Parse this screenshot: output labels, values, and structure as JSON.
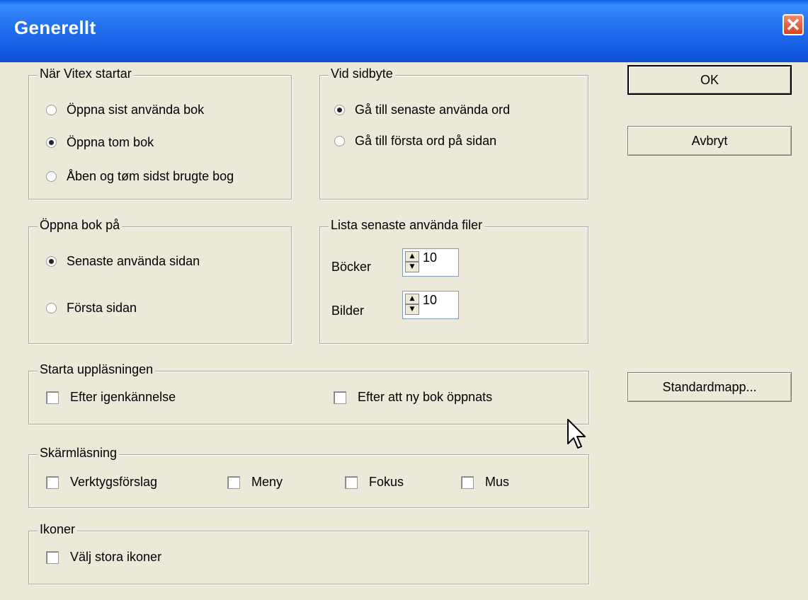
{
  "window": {
    "title": "Generellt",
    "close_label": "✕"
  },
  "groups": {
    "startup": {
      "label": "När Vitex startar",
      "options": [
        {
          "label": "Öppna sist använda bok",
          "selected": false
        },
        {
          "label": "Öppna tom bok",
          "selected": true
        },
        {
          "label": "Åben og tøm sidst brugte bog",
          "selected": false
        }
      ]
    },
    "pagechange": {
      "label": "Vid sidbyte",
      "options": [
        {
          "label": "Gå till senaste använda ord",
          "selected": true
        },
        {
          "label": "Gå till första ord på sidan",
          "selected": false
        }
      ]
    },
    "openbook": {
      "label": "Öppna bok på",
      "options": [
        {
          "label": "Senaste använda sidan",
          "selected": true
        },
        {
          "label": "Första sidan",
          "selected": false
        }
      ]
    },
    "recent": {
      "label": "Lista senaste använda filer",
      "books_label": "Böcker",
      "books_value": "10",
      "images_label": "Bilder",
      "images_value": "10"
    },
    "readaloud": {
      "label": "Starta uppläsningen",
      "options": [
        {
          "label": "Efter igenkännelse",
          "checked": false
        },
        {
          "label": "Efter att ny bok öppnats",
          "checked": false
        }
      ]
    },
    "screenreading": {
      "label": "Skärmläsning",
      "options": [
        {
          "label": "Verktygsförslag",
          "checked": false
        },
        {
          "label": "Meny",
          "checked": false
        },
        {
          "label": "Fokus",
          "checked": false
        },
        {
          "label": "Mus",
          "checked": false
        }
      ]
    },
    "icons": {
      "label": "Ikoner",
      "options": [
        {
          "label": "Välj stora ikoner",
          "checked": false
        }
      ]
    }
  },
  "buttons": {
    "ok": "OK",
    "cancel": "Avbryt",
    "default_folder": "Standardmapp..."
  }
}
